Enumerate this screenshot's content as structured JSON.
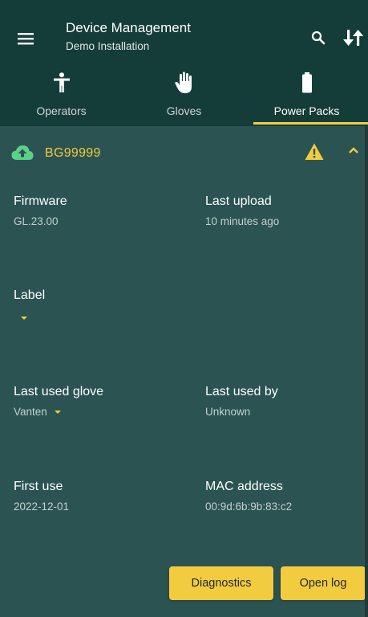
{
  "appbar": {
    "title": "Device Management",
    "subtitle": "Demo Installation",
    "menu_icon": "menu-icon",
    "search_icon": "search-icon",
    "sort_icon": "sort-icon"
  },
  "tabs": [
    {
      "label": "Operators",
      "icon": "person-icon",
      "active": false
    },
    {
      "label": "Gloves",
      "icon": "glove-icon",
      "active": false
    },
    {
      "label": "Power Packs",
      "icon": "battery-icon",
      "active": true
    }
  ],
  "device": {
    "id": "BG99999",
    "status_icon": "cloud-upload-icon",
    "warning_icon": "warning-icon",
    "collapse_icon": "chevron-up-icon"
  },
  "fields": {
    "firmware": {
      "label": "Firmware",
      "value": "GL.23.00"
    },
    "last_upload": {
      "label": "Last upload",
      "value": "10 minutes ago"
    },
    "label": {
      "label": "Label",
      "value": ""
    },
    "last_used_glove": {
      "label": "Last used glove",
      "value": "Vanten"
    },
    "last_used_by": {
      "label": "Last used by",
      "value": "Unknown"
    },
    "first_use": {
      "label": "First use",
      "value": "2022-12-01"
    },
    "mac_address": {
      "label": "MAC address",
      "value": "00:9d:6b:9b:83:c2"
    }
  },
  "actions": {
    "diagnostics": "Diagnostics",
    "open_log": "Open log"
  },
  "colors": {
    "appbar": "#143d3a",
    "background": "#2b5351",
    "accent": "#f3cb3f",
    "text": "#ffffff",
    "secondary_text": "#c2d1cf"
  }
}
